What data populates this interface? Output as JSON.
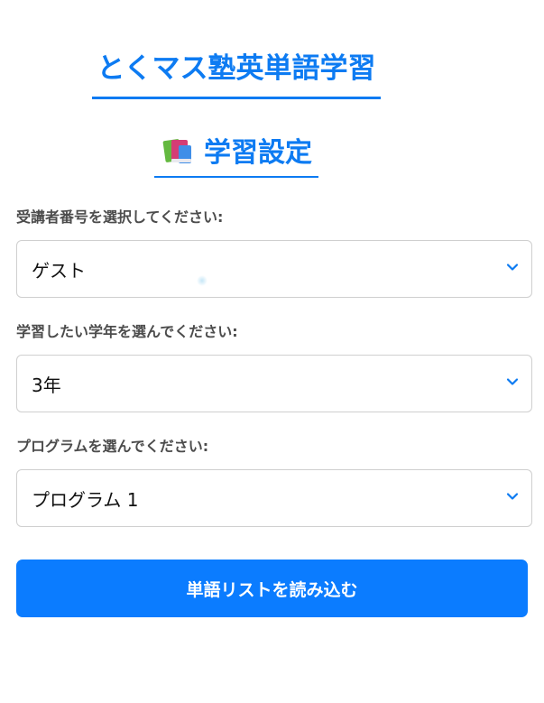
{
  "app_title": "とくマス塾英単語学習",
  "section": {
    "icon": "books-icon",
    "title": "学習設定"
  },
  "fields": [
    {
      "label": "受講者番号を選択してください:",
      "selected": "ゲスト"
    },
    {
      "label": "学習したい学年を選んでください:",
      "selected": "3年"
    },
    {
      "label": "プログラムを選んでください:",
      "selected": "プログラム 1"
    }
  ],
  "load_button_label": "単語リストを読み込む",
  "colors": {
    "accent": "#0d7bf2",
    "button": "#0b7cff",
    "label": "#4c4c4c",
    "border": "#cfcfcf"
  }
}
